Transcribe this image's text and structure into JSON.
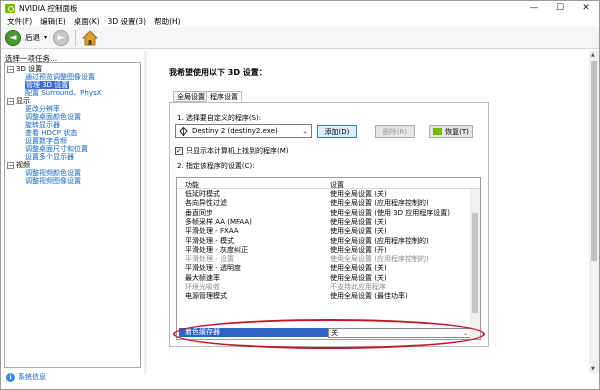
{
  "window": {
    "title": "NVIDIA 控制面板",
    "controls": {
      "minimize": "—",
      "maximize": "☐",
      "close": "✕"
    }
  },
  "menu": [
    "文件(F)",
    "编辑(E)",
    "桌面(K)",
    "3D 设置(3)",
    "帮助(H)"
  ],
  "toolbar": {
    "back_label": "后退",
    "back_glyph": "◄",
    "forward_glyph": "►",
    "caret": "▾"
  },
  "left_panel": {
    "heading": "选择一项任务...",
    "tree": [
      {
        "kind": "cat",
        "expander": "−",
        "label": "3D 设置"
      },
      {
        "kind": "link",
        "label": "通过预览调整图像设置"
      },
      {
        "kind": "sel",
        "label": "管理 3D 设置"
      },
      {
        "kind": "link",
        "label": "配置 Surround、PhysX"
      },
      {
        "kind": "cat",
        "expander": "−",
        "label": "显示"
      },
      {
        "kind": "link",
        "label": "更改分辨率"
      },
      {
        "kind": "link",
        "label": "调整桌面颜色设置"
      },
      {
        "kind": "link",
        "label": "旋转显示器"
      },
      {
        "kind": "link",
        "label": "查看 HDCP 状态"
      },
      {
        "kind": "link",
        "label": "设置数字音频"
      },
      {
        "kind": "link",
        "label": "调整桌面尺寸和位置"
      },
      {
        "kind": "link",
        "label": "设置多个显示器"
      },
      {
        "kind": "cat",
        "expander": "−",
        "label": "视频"
      },
      {
        "kind": "link",
        "label": "调整视频颜色设置"
      },
      {
        "kind": "link",
        "label": "调整视频图像设置"
      }
    ],
    "system_info": {
      "icon": "i",
      "label": "系统信息"
    }
  },
  "main": {
    "title": "我希望使用以下 3D 设置：",
    "tabs": [
      "全局设置",
      "程序设置"
    ],
    "step1_label": "1. 选择要自定义的程序(S):",
    "program_select": {
      "value": "Destiny 2 (destiny2.exe)",
      "caret": "⌄"
    },
    "buttons": {
      "add": "添加(D)",
      "remove": "删除(R)",
      "restore": "恢复(T)"
    },
    "checkbox": {
      "label": "只显示本计算机上找到的程序(M)",
      "checked": true,
      "mark": "✓"
    },
    "step2_label": "2. 指定该程序的设置(C):",
    "grid": {
      "headers": {
        "feature": "功能",
        "setting": "设置"
      },
      "rows": [
        {
          "feature": "低延时模式",
          "setting": "使用全局设置 (关)"
        },
        {
          "feature": "各向异性过滤",
          "setting": "使用全局设置 (应用程序控制的)"
        },
        {
          "feature": "垂直同步",
          "setting": "使用全局设置 (使用 3D 应用程序设置)"
        },
        {
          "feature": "多帧采样 AA (MFAA)",
          "setting": "使用全局设置 (关)"
        },
        {
          "feature": "平滑处理 - FXAA",
          "setting": "使用全局设置 (关)"
        },
        {
          "feature": "平滑处理 - 模式",
          "setting": "使用全局设置 (应用程序控制的)"
        },
        {
          "feature": "平滑处理 - 灰度纠正",
          "setting": "使用全局设置 (开)"
        },
        {
          "feature": "平滑处理 - 设置",
          "setting": "使用全局设置 (应用程序控制的)",
          "dim": true
        },
        {
          "feature": "平滑处理 - 透明度",
          "setting": "使用全局设置 (关)"
        },
        {
          "feature": "最大帧速率",
          "setting": "使用全局设置 (关)"
        },
        {
          "feature": "环境光吸收",
          "setting": "不支持此应用程序",
          "dim": true
        },
        {
          "feature": "电源管理模式",
          "setting": "使用全局设置 (最佳功率)"
        },
        {
          "feature": "着色缓存器",
          "setting": "关",
          "highlight": true,
          "caret": "⌄"
        }
      ]
    }
  },
  "colors": {
    "accent": "#76b900",
    "selection": "#2f64c7",
    "annotation": "#c0182a",
    "link": "#1560bd"
  }
}
